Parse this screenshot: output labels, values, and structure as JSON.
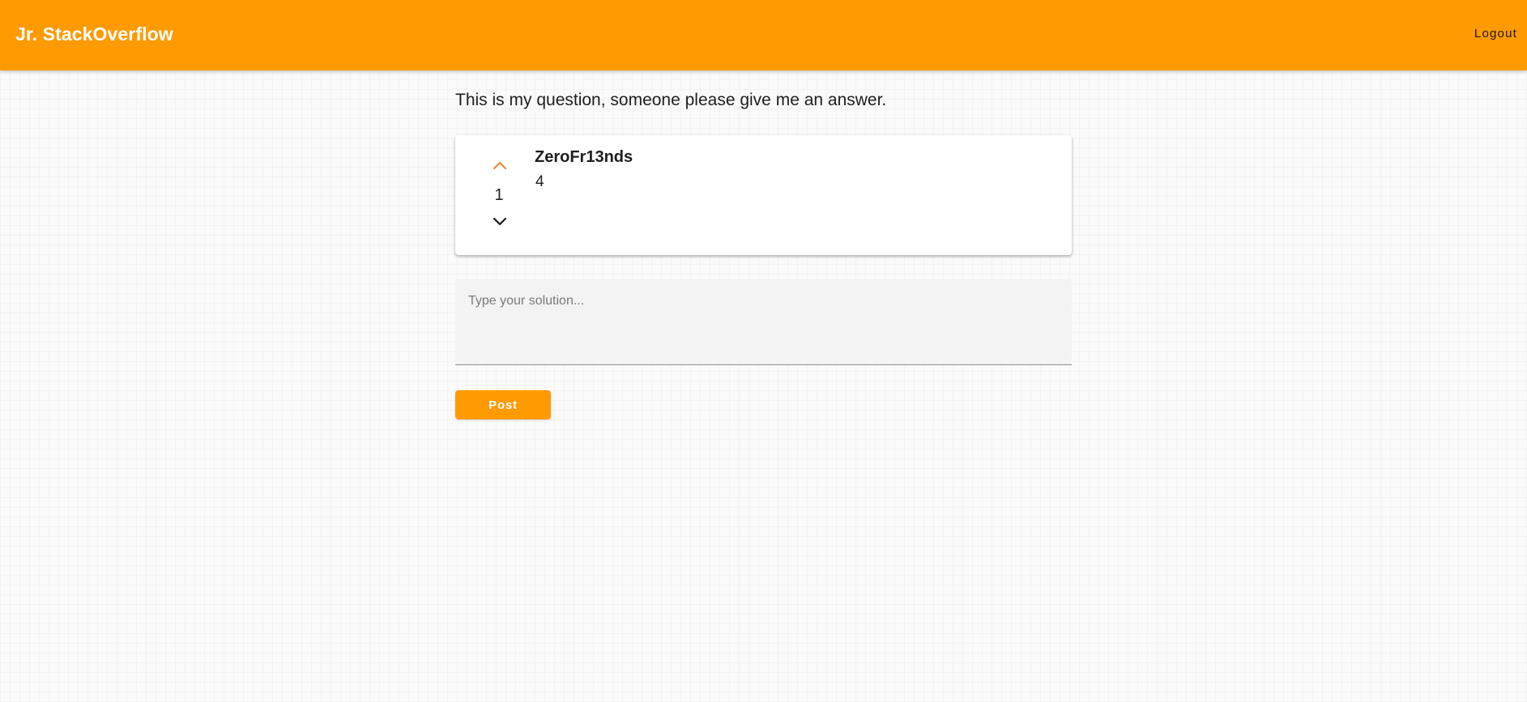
{
  "header": {
    "brand": "Jr. StackOverflow",
    "logout_label": "Logout",
    "background_color": "#ff9a00"
  },
  "question": {
    "text": "This is my question, someone please give me an answer."
  },
  "answer": {
    "author": "ZeroFr13nds",
    "body": "4",
    "votes": "1",
    "upvote_icon": "chevron-up-icon",
    "downvote_icon": "chevron-down-icon",
    "upvote_color": "#f08a3a",
    "downvote_color": "#1a1a1a"
  },
  "solution": {
    "value": "",
    "placeholder": "Type your solution..."
  },
  "post": {
    "label": "Post",
    "color": "#ff9a00"
  }
}
